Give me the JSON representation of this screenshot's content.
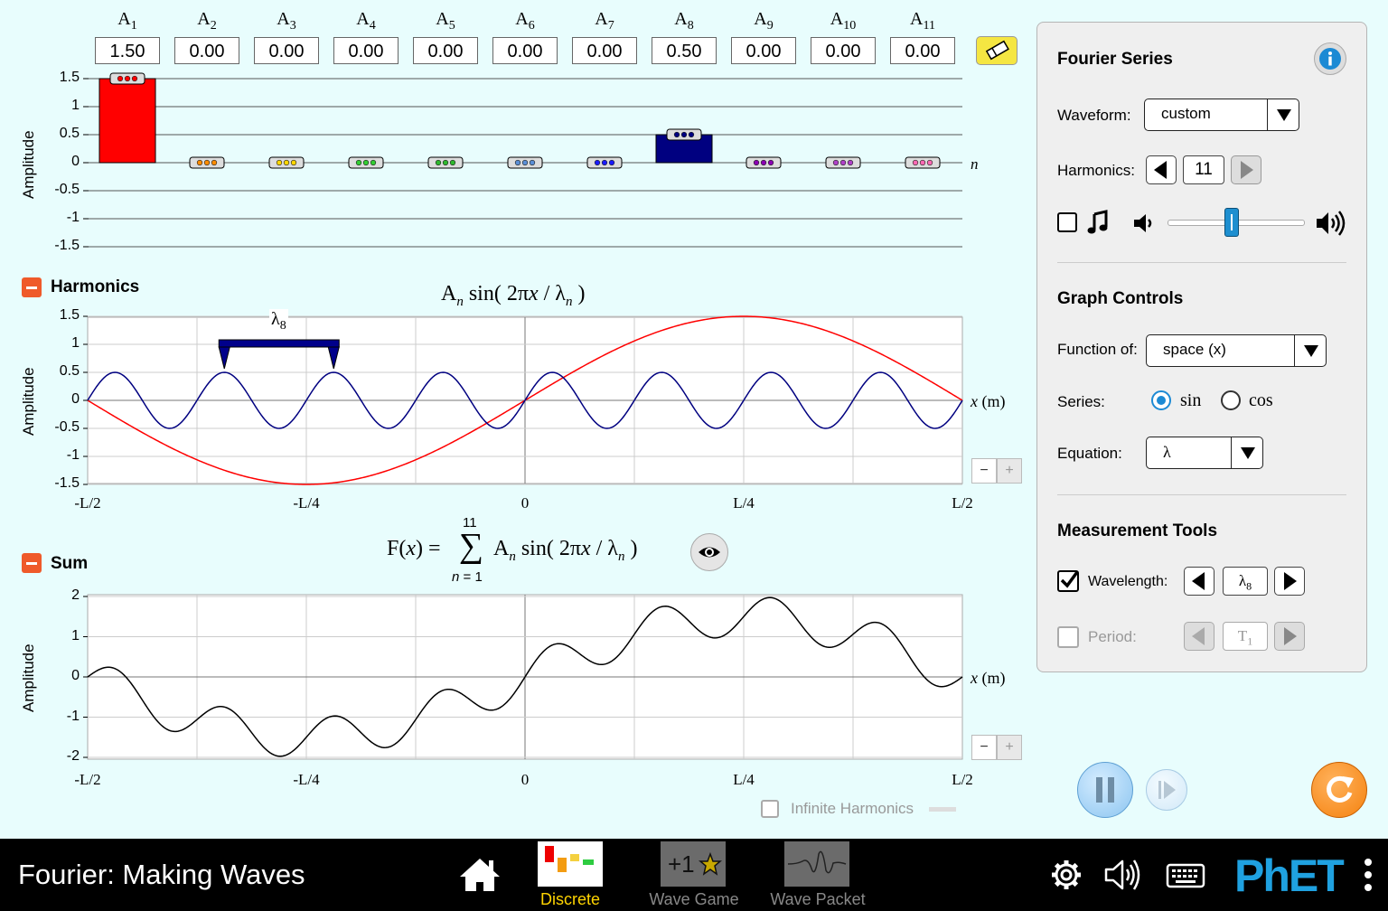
{
  "amplitudes": {
    "labels": [
      "A",
      "A",
      "A",
      "A",
      "A",
      "A",
      "A",
      "A",
      "A",
      "A",
      "A"
    ],
    "subs": [
      "1",
      "2",
      "3",
      "4",
      "5",
      "6",
      "7",
      "8",
      "9",
      "10",
      "11"
    ],
    "values": [
      "1.50",
      "0.00",
      "0.00",
      "0.00",
      "0.00",
      "0.00",
      "0.00",
      "0.50",
      "0.00",
      "0.00",
      "0.00"
    ],
    "y_ticks": [
      "1.5",
      "1",
      "0.5",
      "0",
      "-0.5",
      "-1",
      "-1.5"
    ],
    "y_label": "Amplitude",
    "x_label": "n",
    "colors": [
      "#ff0000",
      "#ff8c00",
      "#ffd700",
      "#32cd32",
      "#2eb82e",
      "#5b8fd6",
      "#1a1aff",
      "#000080",
      "#8b00b3",
      "#b040c8",
      "#ff69b4"
    ]
  },
  "harmonics": {
    "title": "Harmonics",
    "eq_a": "A",
    "eq_n": "n",
    "eq_sin": " sin( 2π",
    "eq_x": "x",
    "eq_slash": " / λ",
    "eq_close": " )",
    "lambda_label": "λ",
    "lambda_sub": "8",
    "y_ticks": [
      "1.5",
      "1",
      "0.5",
      "0",
      "-0.5",
      "-1",
      "-1.5"
    ],
    "y_label": "Amplitude",
    "x_ticks": [
      "-L/2",
      "-L/4",
      "0",
      "L/4",
      "L/2"
    ],
    "x_axis": "x",
    "x_unit": " (m)",
    "zoom_minus": "−",
    "zoom_plus": "+"
  },
  "sum": {
    "title": "Sum",
    "eq_f": "F(",
    "eq_x": "x",
    "eq_eq": ") =",
    "sigma": "∑",
    "sigma_top": "11",
    "sigma_bottom_n": "n",
    "sigma_bottom_rest": " = 1",
    "eq_a": "A",
    "eq_n": "n",
    "eq_sin": " sin( 2π",
    "eq_slash": " / λ",
    "eq_close": " )",
    "y_ticks": [
      "2",
      "1",
      "0",
      "-1",
      "-2"
    ],
    "y_label": "Amplitude",
    "x_ticks": [
      "-L/2",
      "-L/4",
      "0",
      "L/4",
      "L/2"
    ],
    "x_axis": "x",
    "x_unit": " (m)",
    "zoom_minus": "−",
    "zoom_plus": "+",
    "infinite_label": "Infinite Harmonics"
  },
  "panel": {
    "fourier_title": "Fourier Series",
    "waveform_label": "Waveform:",
    "waveform_value": "custom",
    "harmonics_label": "Harmonics:",
    "harmonics_value": "11",
    "graph_title": "Graph Controls",
    "function_label": "Function of:",
    "function_value": "space (x)",
    "series_label": "Series:",
    "series_sin": "sin",
    "series_cos": "cos",
    "equation_label": "Equation:",
    "equation_value": "λ",
    "tools_title": "Measurement Tools",
    "wavelength_label": "Wavelength:",
    "wavelength_value": "λ",
    "wavelength_sub": "8",
    "period_label": "Period:",
    "period_value": "T",
    "period_sub": "1",
    "volume_level": 0.47
  },
  "bottom": {
    "app_title": "Fourier: Making Waves",
    "screens": [
      "Discrete",
      "Wave Game",
      "Wave Packet"
    ],
    "wave_game_icon_text": "+1",
    "phet": "PhET"
  }
}
